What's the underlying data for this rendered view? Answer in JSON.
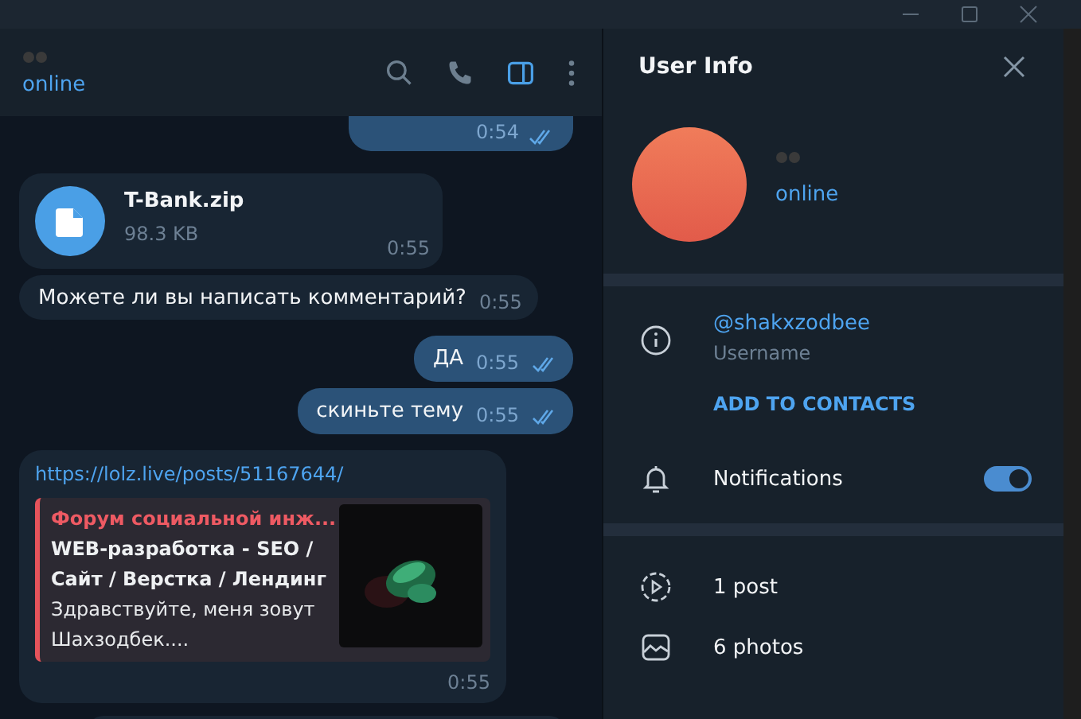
{
  "chat_header": {
    "status": "online"
  },
  "messages": [
    {
      "kind": "cut",
      "outgoing": true,
      "time": "0:54",
      "read": true
    },
    {
      "kind": "file",
      "outgoing": false,
      "file_name": "T-Bank.zip",
      "file_size": "98.3 KB",
      "time": "0:55"
    },
    {
      "kind": "text",
      "outgoing": false,
      "text": "Можете ли вы написать комментарий?",
      "time": "0:55"
    },
    {
      "kind": "text",
      "outgoing": true,
      "text": "ДА",
      "time": "0:55",
      "read": true
    },
    {
      "kind": "text",
      "outgoing": true,
      "text": "скиньте тему",
      "time": "0:55",
      "read": true
    },
    {
      "kind": "link",
      "outgoing": false,
      "url": "https://lolz.live/posts/51167644/",
      "preview_site": "Форум социальной инж...",
      "preview_title": "WEB-разработка - SEO / Сайт / Верстка / Лендинг",
      "preview_text": "Здравствуйте, меня зовут Шахзодбек....",
      "time": "0:55"
    }
  ],
  "user_info": {
    "title": "User Info",
    "status": "online",
    "username": "@shakxzodbee",
    "username_label": "Username",
    "add_contact": "ADD TO CONTACTS",
    "notifications": {
      "label": "Notifications",
      "on": true
    },
    "media": [
      {
        "kind": "posts",
        "label": "1 post"
      },
      {
        "kind": "photos",
        "label": "6 photos"
      }
    ]
  }
}
